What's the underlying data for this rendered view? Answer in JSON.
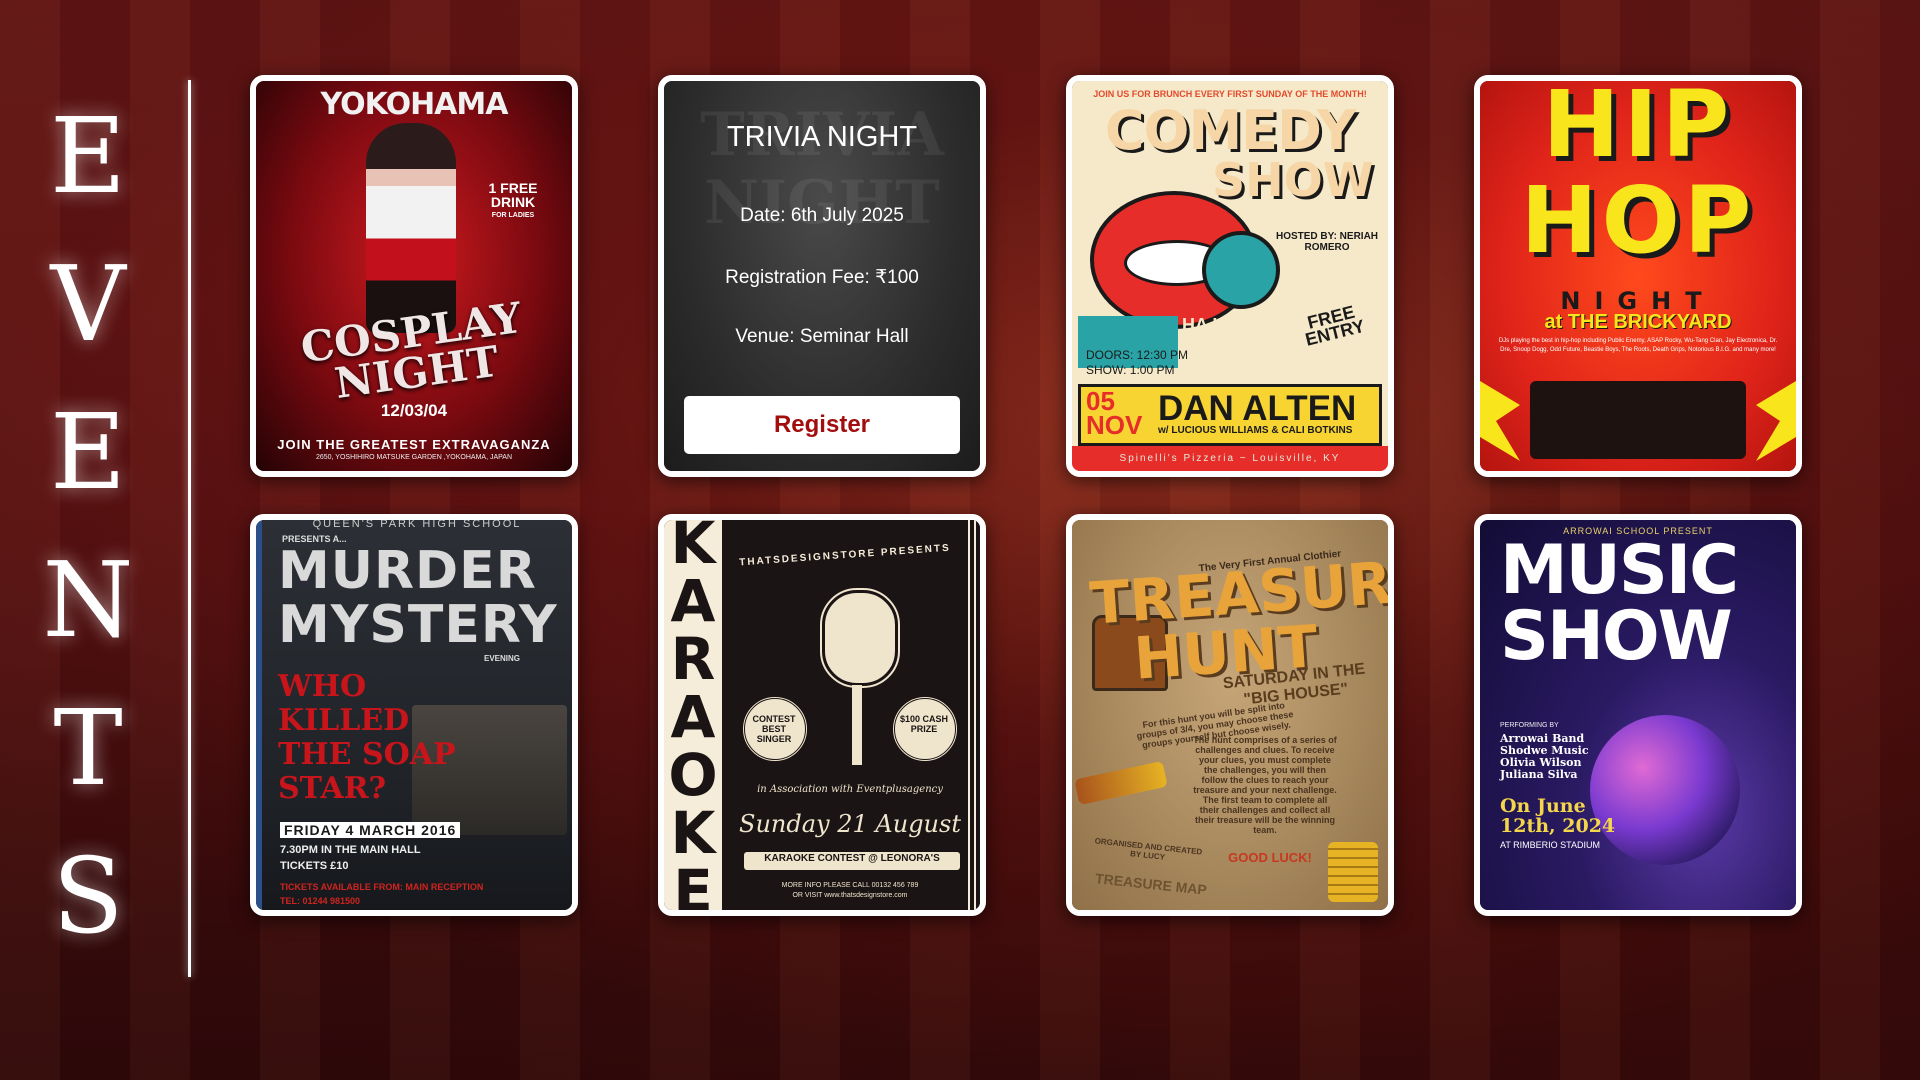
{
  "page": {
    "heading_letters": [
      "E",
      "V",
      "E",
      "N",
      "T",
      "S"
    ]
  },
  "colors": {
    "accent": "#a20e0e",
    "card_border": "#ffffff",
    "background": "#4a0f10"
  },
  "events": {
    "cosplay": {
      "top": "YOKOHAMA",
      "offer": "1 FREE DRINK",
      "offer_small": "FOR LADIES",
      "title": "COSPLAY NIGHT",
      "date": "12/03/04",
      "tagline": "JOIN THE GREATEST EXTRAVAGANZA",
      "address": "2650, YOSHIHIRO MATSUKE GARDEN ,YOKOHAMA, JAPAN"
    },
    "trivia": {
      "title": "TRIVIA NIGHT",
      "date": "Date: 6th July 2025",
      "fee": "Registration Fee: ₹100",
      "venue": "Venue: Seminar Hall",
      "register_label": "Register"
    },
    "comedy": {
      "top": "JOIN US FOR BRUNCH EVERY FIRST SUNDAY OF THE MONTH!",
      "title_1": "COMEDY",
      "title_2": "SHOW",
      "hosted": "HOSTED BY: NERIAH ROMERO",
      "free": "FREE ENTRY",
      "haha": "HA HA HA",
      "doors": "DOORS: 12:30 PM",
      "show": "SHOW: 1:00 PM",
      "date": "05 NOV",
      "performer": "DAN ALTEN",
      "with": "w/ LUCIOUS WILLIAMS & CALI BOTKINS",
      "venue": "Spinelli's Pizzeria ~ Louisville, KY"
    },
    "hiphop": {
      "title_1": "HIP",
      "title_2": "HOP",
      "night": "NIGHT",
      "venue": "at THE BRICKYARD",
      "desc": "DJs playing the best in hip-hop including Public Enemy, ASAP Rocky, Wu-Tang Clan, Jay Electronica, Dr. Dre, Snoop Dogg, Odd Future, Beastie Boys, The Roots, Death Grips, Notorious B.I.G. and many more!"
    },
    "murder": {
      "school": "QUEEN'S PARK HIGH SCHOOL",
      "presents": "PRESENTS A...",
      "title_1": "MURDER",
      "title_2": "MYSTERY",
      "evening": "EVENING",
      "who": "WHO KILLED THE SOAP STAR?",
      "date": "FRIDAY 4 MARCH 2016",
      "time": "7.30PM IN THE MAIN HALL",
      "tickets": "TICKETS £10",
      "available": "TICKETS AVAILABLE FROM: MAIN RECEPTION",
      "tel": "TEL: 01244 981500"
    },
    "karaoke": {
      "vertical": "KARAOKE",
      "presents": "THATSDESIGNSTORE PRESENTS",
      "badge_left": "CONTEST BEST SINGER",
      "badge_right": "$100 CASH PRIZE",
      "assoc": "in Association with Eventplusagency",
      "date": "Sunday 21 August",
      "banner": "KARAOKE CONTEST @ LEONORA'S",
      "more_1": "MORE INFO PLEASE CALL 00132 456 789",
      "more_2": "OR VISIT www.thatsdesignstore.com"
    },
    "treasure": {
      "annual": "The Very First Annual Clothier",
      "title_1": "TREASURE",
      "title_2": "HUNT",
      "saturday": "SATURDAY IN THE \"BIG HOUSE\"",
      "groups": "For this hunt you will be split into groups of 3/4, you may choose these groups yourself but choose wisely.",
      "rules": "The hunt comprises of a series of challenges and clues. To receive your clues, you must complete the challenges, you will then follow the clues to reach your treasure and your next challenge. The first team to complete all their challenges and collect all their treasure will be the winning team.",
      "good_luck": "GOOD LUCK!",
      "organized": "ORGANISED AND CREATED BY LUCY",
      "map": "TREASURE MAP"
    },
    "music": {
      "presenter": "ARROWAI SCHOOL PRESENT",
      "title_1": "MUSIC",
      "title_2": "SHOW",
      "performing": "PERFORMING BY",
      "names": [
        "Arrowai Band",
        "Shodwe Music",
        "Olivia Wilson",
        "Juliana Silva"
      ],
      "date": "On June 12th, 2024",
      "venue": "AT RIMBERIO STADIUM"
    }
  }
}
